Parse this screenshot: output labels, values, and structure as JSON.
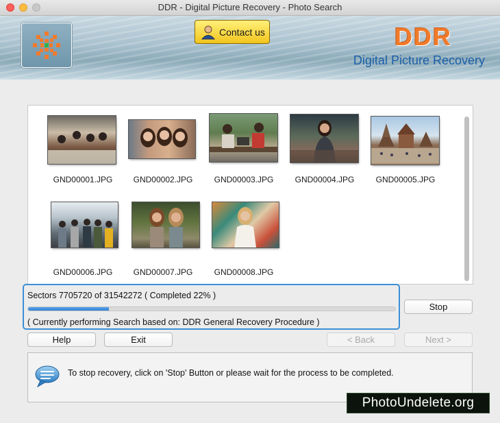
{
  "window": {
    "title": "DDR - Digital Picture Recovery - Photo Search"
  },
  "header": {
    "contact_label": "Contact us",
    "brand_name": "DDR",
    "brand_subtitle": "Digital Picture Recovery",
    "brand_color": "#f07a2a",
    "subtitle_color": "#1b5ea8"
  },
  "gallery": {
    "items": [
      {
        "label": "GND00001.JPG",
        "scene": "group-of-friends-dining"
      },
      {
        "label": "GND00002.JPG",
        "scene": "three-women-smiling"
      },
      {
        "label": "GND00003.JPG",
        "scene": "two-men-on-bench"
      },
      {
        "label": "GND00004.JPG",
        "scene": "woman-outdoors-evening"
      },
      {
        "label": "GND00005.JPG",
        "scene": "temple-square"
      },
      {
        "label": "GND00006.JPG",
        "scene": "group-under-glass-roof"
      },
      {
        "label": "GND00007.JPG",
        "scene": "two-women-in-park"
      },
      {
        "label": "GND00008.JPG",
        "scene": "woman-by-mural"
      }
    ]
  },
  "progress": {
    "sectors_text": "Sectors 7705720 of 31542272    ( Completed 22% )",
    "percent": 22,
    "procedure_text": "( Currently performing Search based on: DDR General Recovery Procedure )",
    "accent_color": "#3a8fd6"
  },
  "buttons": {
    "stop": "Stop",
    "help": "Help",
    "exit": "Exit",
    "back": "< Back",
    "next": "Next >"
  },
  "message": {
    "text": "To stop recovery, click on 'Stop' Button or please wait for the process to be completed."
  },
  "watermark": {
    "text": "PhotoUndelete.org"
  }
}
